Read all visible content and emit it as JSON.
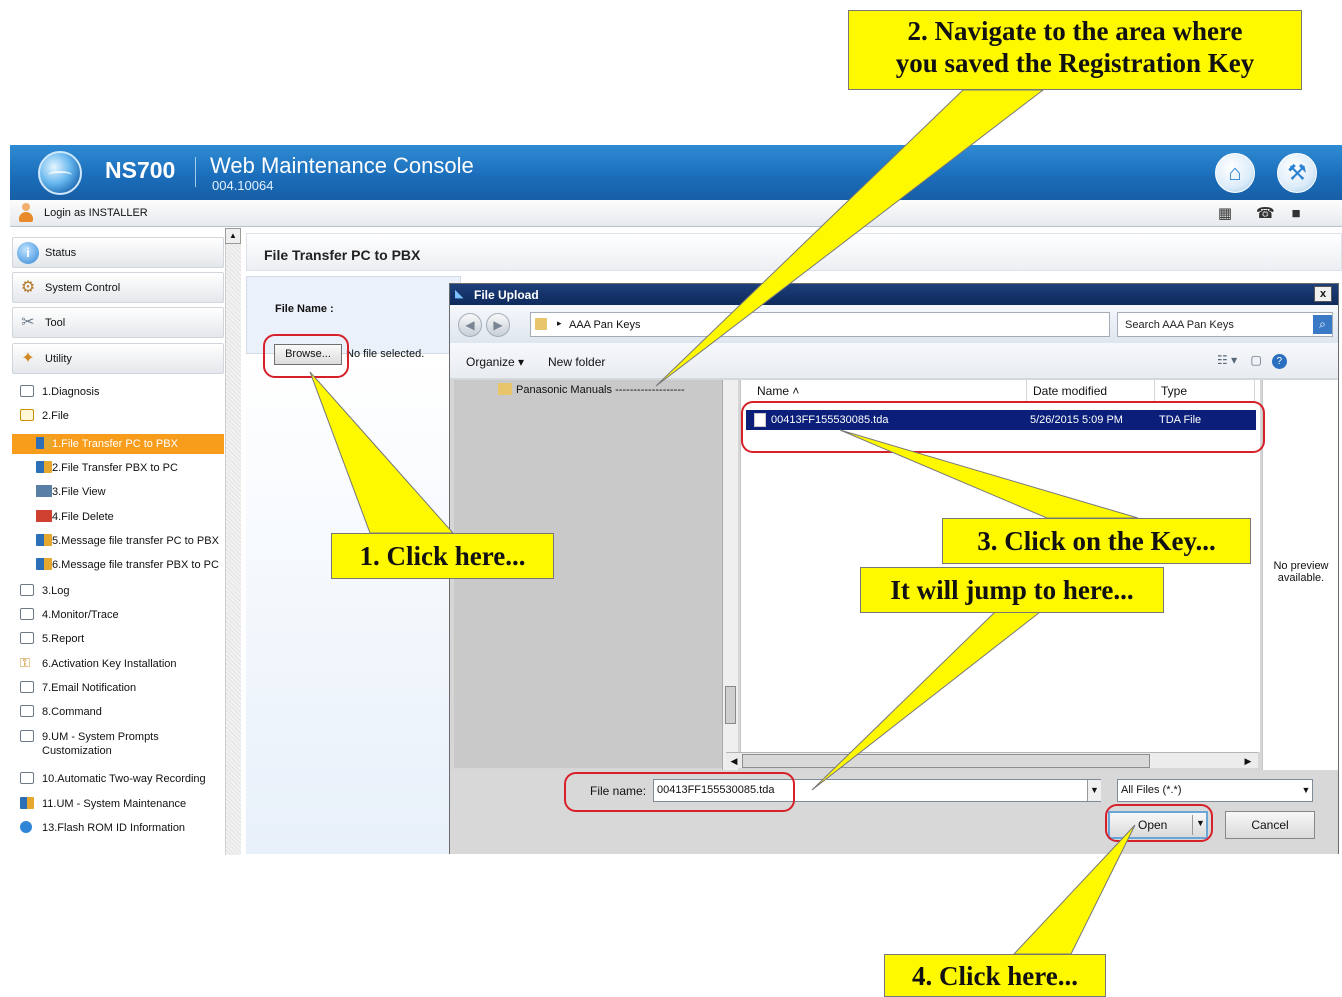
{
  "header": {
    "brand": "NS700",
    "title": "Web Maintenance Console",
    "version": "004.10064",
    "home_icon": "home-icon",
    "wrench_icon": "wrench-icon"
  },
  "login": {
    "text": "Login as INSTALLER"
  },
  "sidebar": {
    "categories": [
      {
        "label": "Status",
        "icon": "info-icon"
      },
      {
        "label": "System Control",
        "icon": "system-control-icon"
      },
      {
        "label": "Tool",
        "icon": "tool-icon"
      },
      {
        "label": "Utility",
        "icon": "utility-icon"
      }
    ],
    "items": [
      {
        "label": "1.Diagnosis",
        "icon": "folder-icon"
      },
      {
        "label": "2.File",
        "icon": "folder-open-icon"
      },
      {
        "label": "1.File Transfer PC to PBX",
        "icon": "file-transfer-icon",
        "selected": true
      },
      {
        "label": "2.File Transfer PBX to PC",
        "icon": "file-transfer-icon"
      },
      {
        "label": "3.File View",
        "icon": "file-view-icon"
      },
      {
        "label": "4.File Delete",
        "icon": "file-delete-icon"
      },
      {
        "label": "5.Message file transfer PC to PBX",
        "icon": "file-transfer-icon"
      },
      {
        "label": "6.Message file transfer PBX to PC",
        "icon": "file-transfer-icon"
      },
      {
        "label": "3.Log",
        "icon": "folder-icon"
      },
      {
        "label": "4.Monitor/Trace",
        "icon": "folder-icon"
      },
      {
        "label": "5.Report",
        "icon": "folder-icon"
      },
      {
        "label": "6.Activation Key Installation",
        "icon": "key-icon"
      },
      {
        "label": "7.Email Notification",
        "icon": "folder-icon"
      },
      {
        "label": "8.Command",
        "icon": "folder-icon"
      },
      {
        "label": "9.UM - System Prompts",
        "label2": "Customization",
        "icon": "folder-icon"
      },
      {
        "label": "10.Automatic Two-way Recording",
        "icon": "folder-icon"
      },
      {
        "label": "11.UM - System Maintenance",
        "icon": "maintenance-icon"
      },
      {
        "label": "13.Flash ROM ID Information",
        "icon": "info-icon"
      }
    ]
  },
  "content": {
    "title": "File Transfer PC to PBX",
    "file_name_label": "File Name :",
    "browse_label": "Browse...",
    "no_file_text": "No file selected."
  },
  "dialog": {
    "title": "File Upload",
    "close_label": "x",
    "address": "AAA Pan Keys",
    "search_placeholder": "Search AAA Pan Keys",
    "organize_label": "Organize",
    "new_folder_label": "New folder",
    "nav_items": [
      {
        "label": "Panasonic Manuals"
      }
    ],
    "columns": [
      "Name",
      "Date modified",
      "Type"
    ],
    "files": [
      {
        "name": "00413FF155530085.tda",
        "date": "5/26/2015 5:09 PM",
        "type": "TDA File",
        "selected": true
      }
    ],
    "preview_text": "No preview available.",
    "file_name_label": "File name:",
    "file_name_value": "00413FF155530085.tda",
    "file_type": "All Files (*.*)",
    "open_label": "Open",
    "cancel_label": "Cancel"
  },
  "callouts": {
    "step1": "1. Click here...",
    "step2_line1": "2. Navigate to the area where",
    "step2_line2": "you saved the Registration Key",
    "step3": "3. Click on the Key...",
    "jump": "It will jump to here...",
    "step4": "4. Click here..."
  },
  "colors": {
    "header_blue": "#1a6cb9",
    "selected_orange": "#f79c1b",
    "callout_yellow": "#fff900",
    "highlight_red": "#d6202a",
    "selection_navy": "#0b1f7a"
  }
}
